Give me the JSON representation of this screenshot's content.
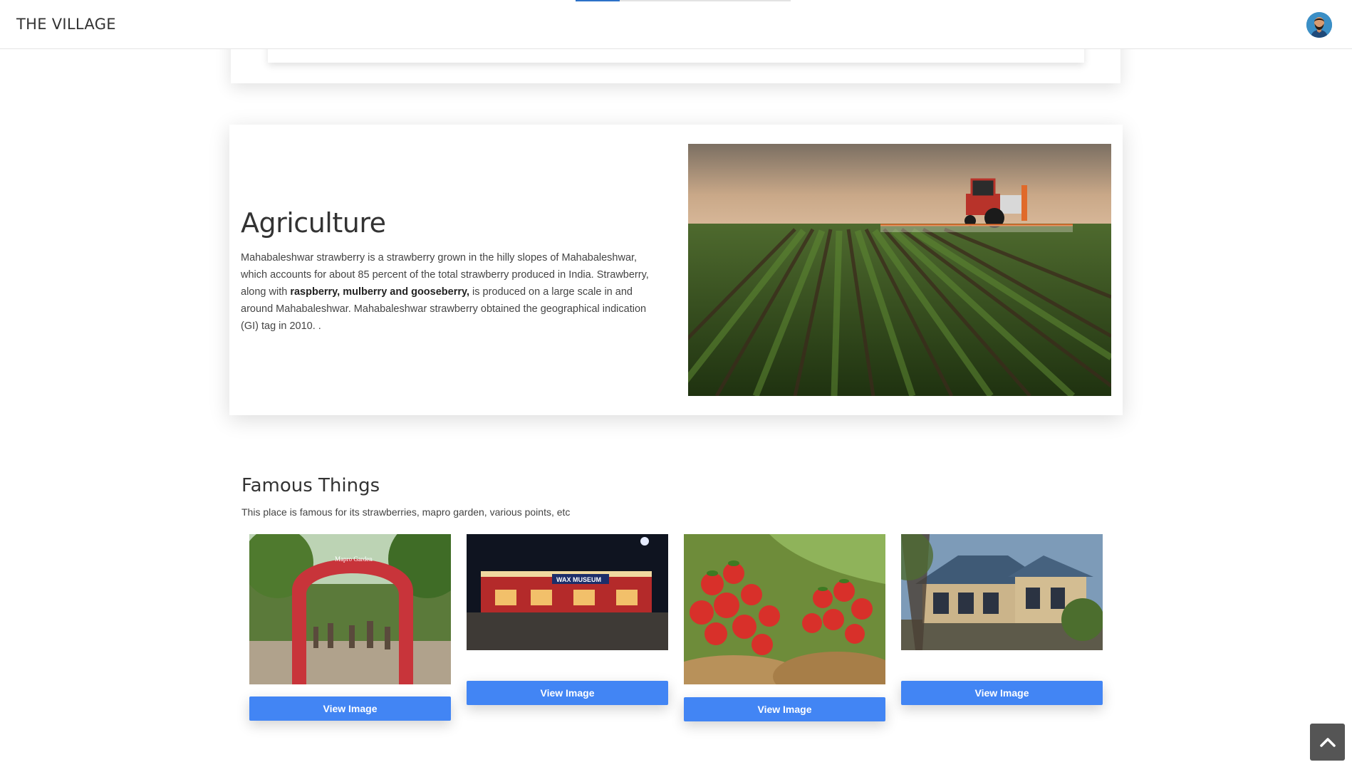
{
  "navbar": {
    "brand": "THE VILLAGE",
    "accent_color": "#2d72c8",
    "avatar_icon": "user-avatar-icon"
  },
  "agriculture": {
    "title": "Agriculture",
    "text_before_bold": "Mahabaleshwar strawberry is a strawberry grown in the hilly slopes of Mahabaleshwar, which accounts for about 85 percent of the total strawberry produced in India. Strawberry, along with ",
    "text_bold": "raspberry, mulberry and gooseberry,",
    "text_after_bold": " is produced on a large scale in and around Mahabaleshwar. Mahabaleshwar strawberry obtained the geographical indication (GI) tag in 2010. .",
    "image": "tractor spraying field rows at sunset"
  },
  "famous": {
    "title": "Famous Things",
    "description": "This place is famous for its strawberries, mapro garden, various points, etc",
    "items": [
      {
        "image": "mapro garden red strawberry arch with visitors",
        "arch_text": "Mapro Garden",
        "button_label": "View Image"
      },
      {
        "image": "wax museum building at night",
        "sign_text": "WAX MUSEUM",
        "button_label": "View Image"
      },
      {
        "image": "baskets of fresh strawberries",
        "button_label": "View Image"
      },
      {
        "image": "heritage building among trees",
        "button_label": "View Image"
      }
    ],
    "button_color": "#4285f4"
  },
  "scroll_top": {
    "icon": "chevron-up-icon"
  }
}
